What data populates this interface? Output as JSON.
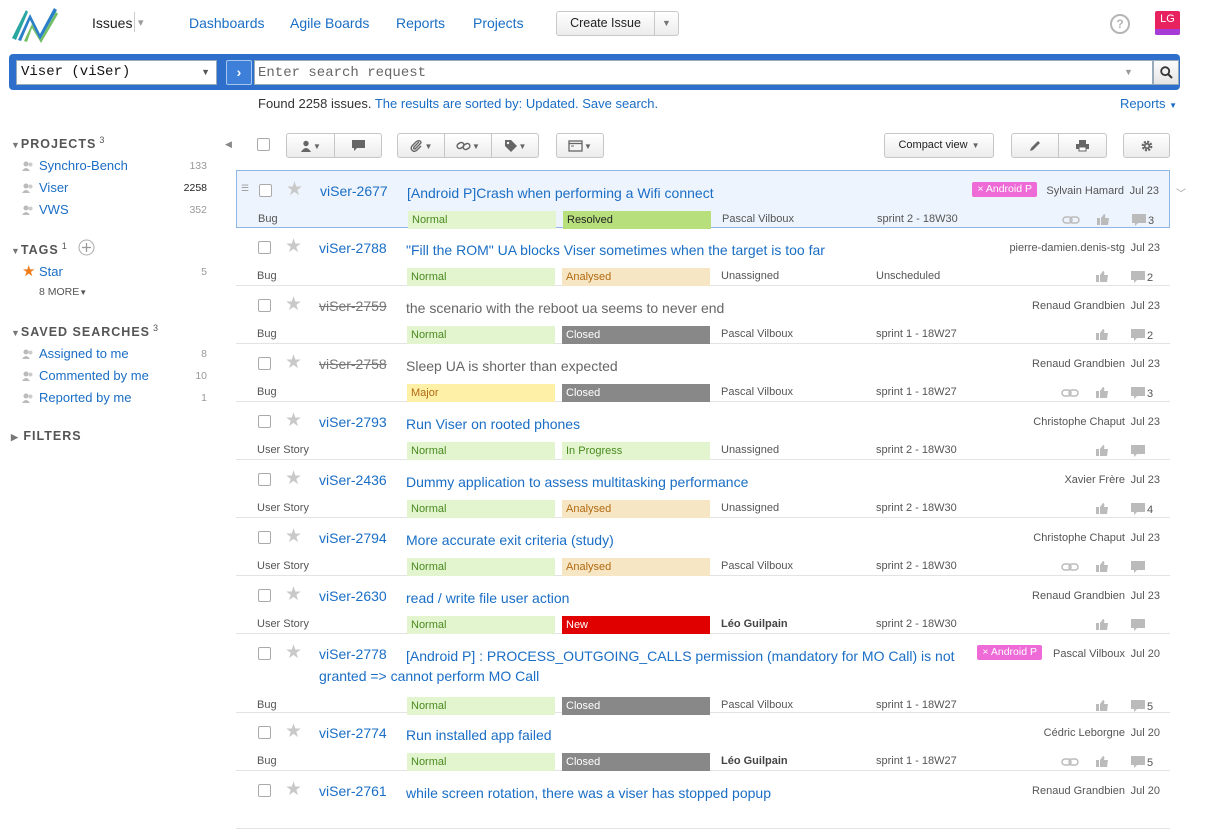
{
  "nav": {
    "issues_label": "Issues",
    "links": [
      "Dashboards",
      "Agile Boards",
      "Reports",
      "Projects"
    ],
    "create_issue": "Create Issue",
    "help": "?",
    "avatar_initials": "LG"
  },
  "search": {
    "project_value": "Viser (viSer)",
    "placeholder": "Enter search request",
    "go": "›"
  },
  "summary": {
    "found": "Found 2258 issues.",
    "sorted": "The results are sorted by: Updated.",
    "save": "Save search.",
    "reports": "Reports"
  },
  "sidebar": {
    "projects_title": "PROJECTS",
    "projects_count": "3",
    "projects": [
      {
        "name": "Synchro-Bench",
        "count": "133"
      },
      {
        "name": "Viser",
        "count": "2258"
      },
      {
        "name": "VWS",
        "count": "352"
      }
    ],
    "tags_title": "TAGS",
    "tags_count": "1",
    "tags": [
      {
        "name": "Star",
        "count": "5"
      }
    ],
    "more_tags": "8 MORE",
    "saved_title": "SAVED SEARCHES",
    "saved_count": "3",
    "saved": [
      {
        "name": "Assigned to me",
        "count": "8"
      },
      {
        "name": "Commented by me",
        "count": "10"
      },
      {
        "name": "Reported by me",
        "count": "1"
      }
    ],
    "filters_title": "FILTERS"
  },
  "toolbar": {
    "compact_view": "Compact view"
  },
  "colors": {
    "normal": "#e3f5cf",
    "major": "#fff0a8",
    "resolved": "#b7e07d",
    "analysed": "#f7e6c4",
    "in_progress": "#e3f5cf",
    "closed": "#888888",
    "new": "#e00000",
    "tag": "#ee6ad6"
  },
  "issues": [
    {
      "id": "viSer-2677",
      "summary": "[Android P]Crash when performing a Wifi connect",
      "type": "Bug",
      "priority": "Normal",
      "state": "Resolved",
      "assignee": "Pascal Vilboux",
      "sprint": "sprint 2 - 18W30",
      "reporter": "Sylvain Hamard",
      "date": "Jul 23",
      "tag": "× Android P",
      "comments": "3",
      "link": true,
      "closed": false
    },
    {
      "id": "viSer-2788",
      "summary": "\"Fill the ROM\" UA blocks Viser sometimes when the target is too far",
      "type": "Bug",
      "priority": "Normal",
      "state": "Analysed",
      "assignee": "Unassigned",
      "sprint": "Unscheduled",
      "reporter": "pierre-damien.denis-stg",
      "date": "Jul 23",
      "tag": "",
      "comments": "2",
      "link": false,
      "closed": false
    },
    {
      "id": "viSer-2759",
      "summary": "the scenario with the reboot ua seems to never end",
      "type": "Bug",
      "priority": "Normal",
      "state": "Closed",
      "assignee": "Pascal Vilboux",
      "sprint": "sprint 1 - 18W27",
      "reporter": "Renaud Grandbien",
      "date": "Jul 23",
      "tag": "",
      "comments": "2",
      "link": false,
      "closed": true
    },
    {
      "id": "viSer-2758",
      "summary": "Sleep UA is shorter than expected",
      "type": "Bug",
      "priority": "Major",
      "state": "Closed",
      "assignee": "Pascal Vilboux",
      "sprint": "sprint 1 - 18W27",
      "reporter": "Renaud Grandbien",
      "date": "Jul 23",
      "tag": "",
      "comments": "3",
      "link": true,
      "closed": true
    },
    {
      "id": "viSer-2793",
      "summary": "Run Viser on rooted phones",
      "type": "User Story",
      "priority": "Normal",
      "state": "In Progress",
      "assignee": "Unassigned",
      "sprint": "sprint 2 - 18W30",
      "reporter": "Christophe Chaput",
      "date": "Jul 23",
      "tag": "",
      "comments": "",
      "link": false,
      "closed": false
    },
    {
      "id": "viSer-2436",
      "summary": "Dummy application to assess multitasking performance",
      "type": "User Story",
      "priority": "Normal",
      "state": "Analysed",
      "assignee": "Unassigned",
      "sprint": "sprint 2 - 18W30",
      "reporter": "Xavier Frère",
      "date": "Jul 23",
      "tag": "",
      "comments": "4",
      "link": false,
      "closed": false
    },
    {
      "id": "viSer-2794",
      "summary": "More accurate exit criteria (study)",
      "type": "User Story",
      "priority": "Normal",
      "state": "Analysed",
      "assignee": "Pascal Vilboux",
      "sprint": "sprint 2 - 18W30",
      "reporter": "Christophe Chaput",
      "date": "Jul 23",
      "tag": "",
      "comments": "",
      "link": true,
      "closed": false
    },
    {
      "id": "viSer-2630",
      "summary": "read / write file user action",
      "type": "User Story",
      "priority": "Normal",
      "state": "New",
      "assignee": "Léo Guilpain",
      "sprint": "sprint 2 - 18W30",
      "reporter": "Renaud Grandbien",
      "date": "Jul 23",
      "tag": "",
      "comments": "",
      "link": false,
      "closed": false
    },
    {
      "id": "viSer-2778",
      "summary": "[Android P] : PROCESS_OUTGOING_CALLS permission (mandatory for MO Call) is not granted => cannot perform MO Call",
      "type": "Bug",
      "priority": "Normal",
      "state": "Closed",
      "assignee": "Pascal Vilboux",
      "sprint": "sprint 1 - 18W27",
      "reporter": "Pascal Vilboux",
      "date": "Jul 20",
      "tag": "× Android P",
      "comments": "5",
      "link": false,
      "closed": false
    },
    {
      "id": "viSer-2774",
      "summary": "Run installed app failed",
      "type": "Bug",
      "priority": "Normal",
      "state": "Closed",
      "assignee": "Léo Guilpain",
      "sprint": "sprint 1 - 18W27",
      "reporter": "Cédric Leborgne",
      "date": "Jul 20",
      "tag": "",
      "comments": "5",
      "link": true,
      "closed": false
    },
    {
      "id": "viSer-2761",
      "summary": "while screen rotation, there was a viser has stopped popup",
      "type": "",
      "priority": "",
      "state": "",
      "assignee": "",
      "sprint": "",
      "reporter": "Renaud Grandbien",
      "date": "Jul 20",
      "tag": "",
      "comments": "",
      "link": false,
      "closed": false
    }
  ]
}
